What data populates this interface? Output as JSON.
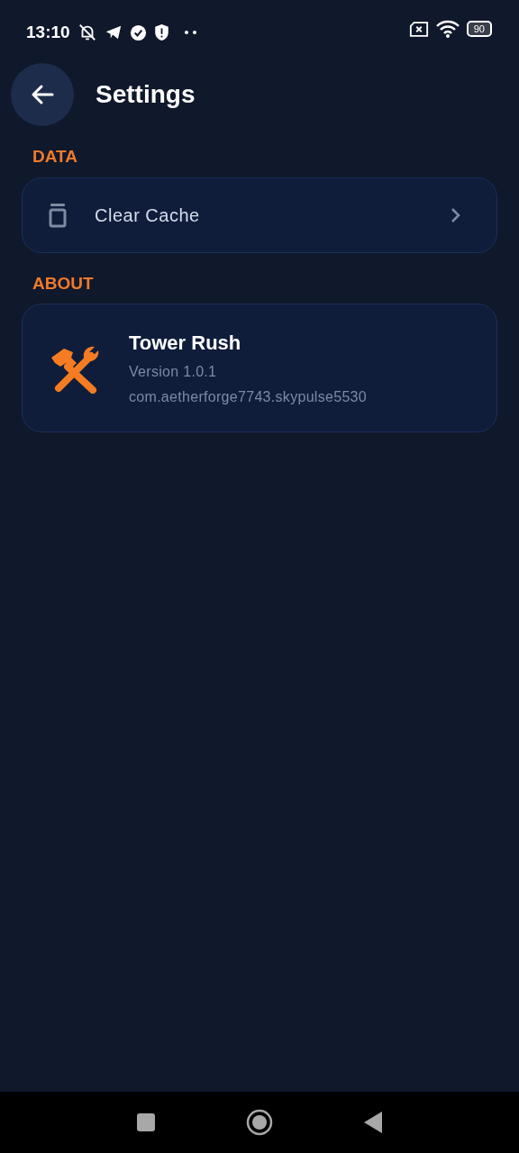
{
  "status_bar": {
    "time": "13:10",
    "battery": "90"
  },
  "header": {
    "title": "Settings"
  },
  "sections": [
    {
      "title": "DATA",
      "kind": "action",
      "label": "Clear Cache"
    },
    {
      "title": "ABOUT",
      "kind": "app_info",
      "name": "Tower Rush",
      "version": "Version 1.0.1",
      "package": "com.aetherforge7743.skypulse5530"
    }
  ]
}
